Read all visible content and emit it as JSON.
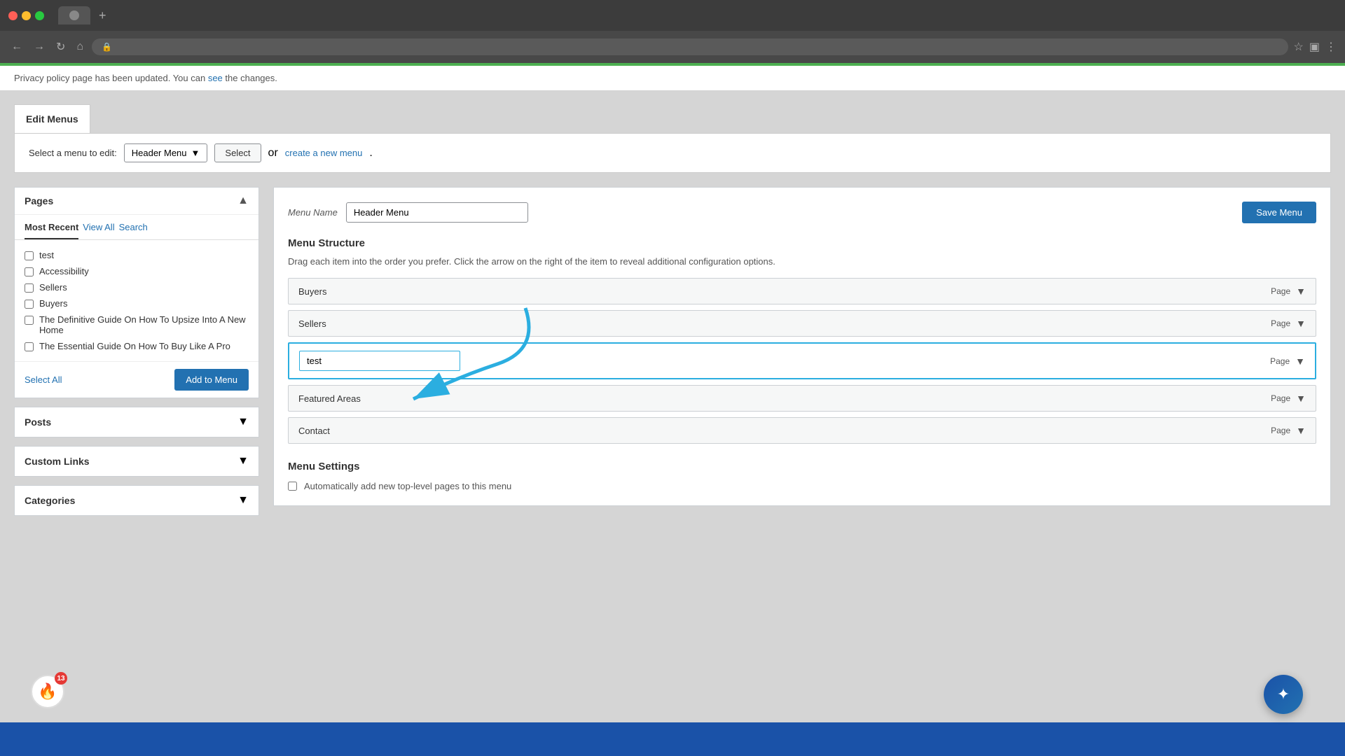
{
  "browser": {
    "tab_title": "",
    "address": "",
    "add_tab": "+"
  },
  "notice": {
    "text": "Privacy policy page has been updated. You can ",
    "link_text": "see",
    "text2": " the changes."
  },
  "page_title": "Edit Menus",
  "select_menu": {
    "label": "Select a menu to edit:",
    "current": "Header Menu",
    "select_btn": "Select",
    "or_text": "or",
    "create_link": "create a new menu",
    "period": "."
  },
  "left_panel": {
    "title": "Pages",
    "tabs": [
      "Most Recent",
      "View All",
      "Search"
    ],
    "items": [
      {
        "label": "test",
        "checked": false
      },
      {
        "label": "Accessibility",
        "checked": false
      },
      {
        "label": "Sellers",
        "checked": false
      },
      {
        "label": "Buyers",
        "checked": false
      },
      {
        "label": "The Definitive Guide On How To Upsize Into A New Home",
        "checked": false
      },
      {
        "label": "The Essential Guide On How To Buy Like A Pro",
        "checked": false
      }
    ],
    "select_all": "Select All",
    "add_to_menu": "Add to Menu"
  },
  "posts_panel": {
    "title": "Posts"
  },
  "custom_links_panel": {
    "title": "Custom Links"
  },
  "categories_panel": {
    "title": "Categories"
  },
  "right_panel": {
    "menu_name_label": "Menu Name",
    "menu_name_value": "Header Menu",
    "save_btn": "Save Menu",
    "structure_title": "Menu Structure",
    "structure_desc": "Drag each item into the order you prefer. Click the arrow on the right of the item to reveal additional configuration options.",
    "items": [
      {
        "name": "Buyers",
        "type": "Page",
        "is_editing": false
      },
      {
        "name": "Sellers",
        "type": "Page",
        "is_editing": false
      },
      {
        "name": "test",
        "type": "Page",
        "is_editing": true
      },
      {
        "name": "Featured Areas",
        "type": "Page",
        "is_editing": false
      },
      {
        "name": "Contact",
        "type": "Page",
        "is_editing": false
      }
    ],
    "settings_title": "Menu Settings",
    "settings_desc": "Automatically add new top-level pages to this menu"
  },
  "flame_badge": "13",
  "colors": {
    "accent_blue": "#2271b1",
    "cyan": "#2baee0",
    "save_btn_bg": "#2271b1"
  }
}
